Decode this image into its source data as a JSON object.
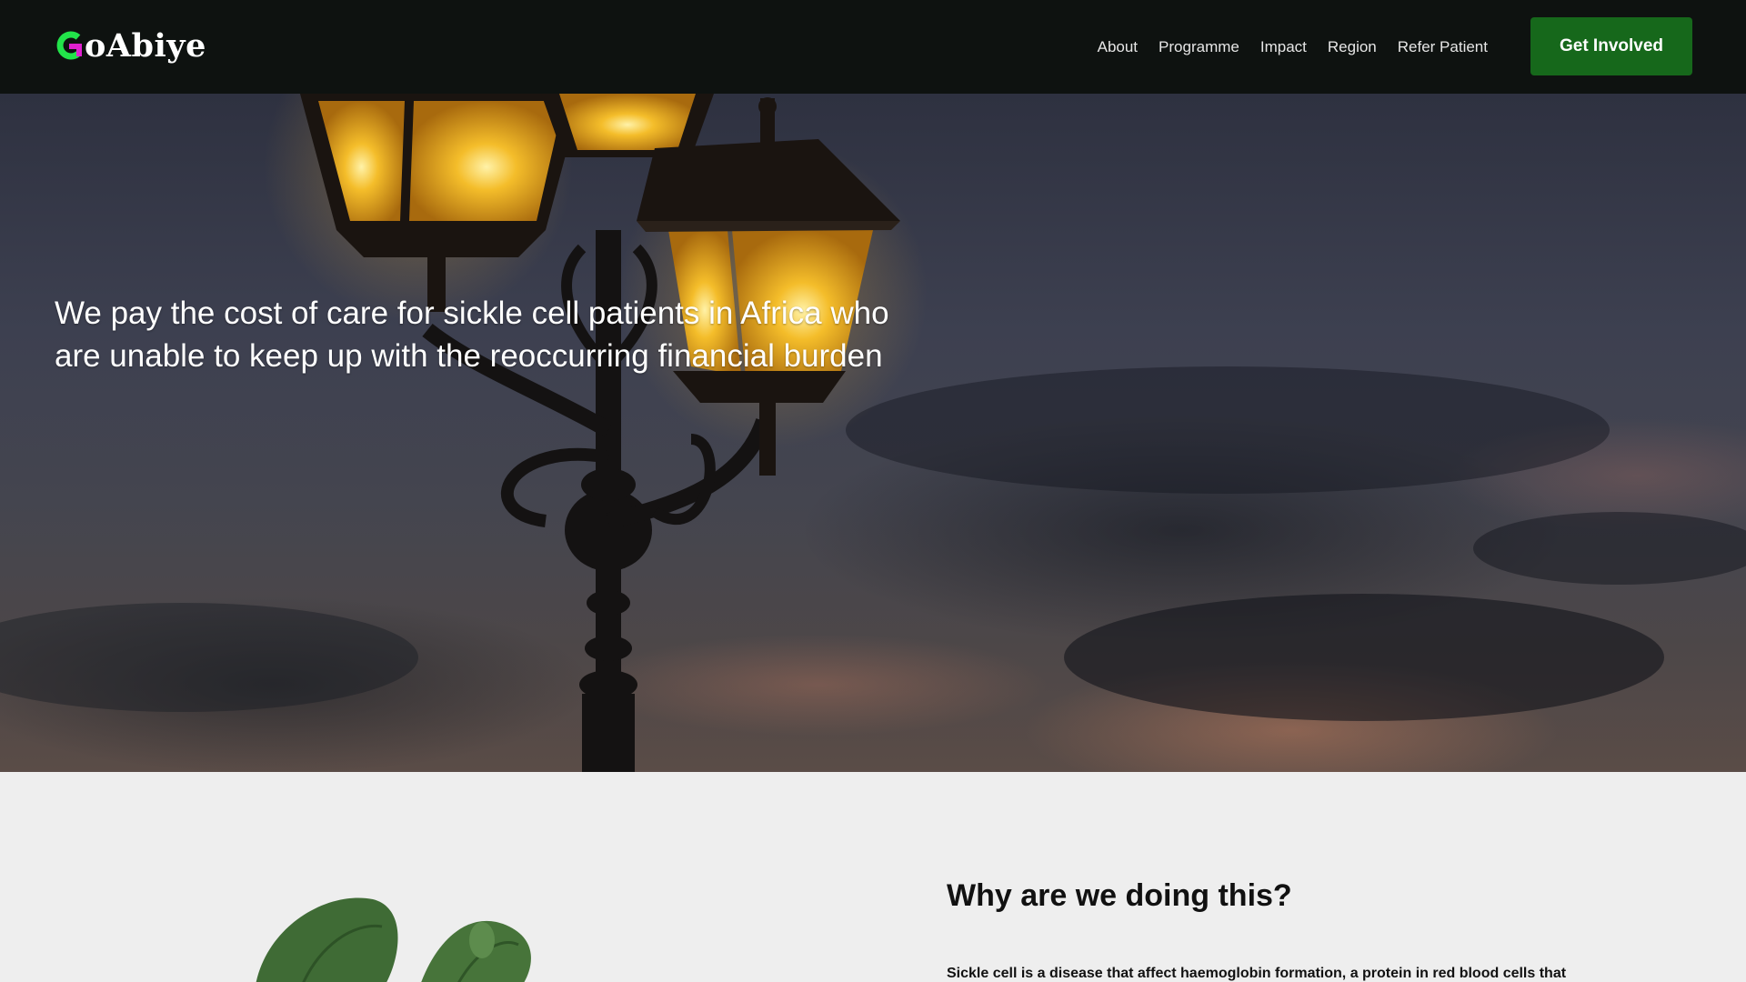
{
  "header": {
    "logo_text": "GoAbiye",
    "logo_mark": "G",
    "logo_rest": "oAbiye",
    "nav": [
      {
        "label": "About"
      },
      {
        "label": "Programme"
      },
      {
        "label": "Impact"
      },
      {
        "label": "Region"
      },
      {
        "label": "Refer Patient"
      }
    ],
    "cta_label": "Get Involved"
  },
  "hero": {
    "headline": "We pay the cost of care for sickle cell patients in Africa who are unable to keep up with the reoccurring financial burden",
    "background_image": "street-lamp-dusk-sky"
  },
  "about": {
    "heading": "Why are we doing this?",
    "body": "Sickle cell is a disease that affect haemoglobin formation, a protein in red blood cells that",
    "image": "potted-plant-leaves"
  },
  "colors": {
    "header_bg": "#0e1210",
    "cta_bg": "#16681b",
    "logo_green": "#22e34a",
    "logo_magenta": "#e020d0",
    "section_bg": "#eeeeee",
    "lamp_glow": "#f2b41c"
  }
}
